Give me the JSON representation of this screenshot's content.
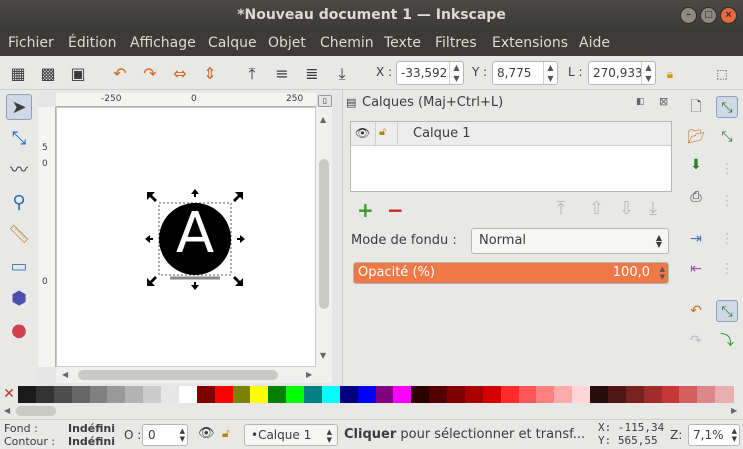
{
  "window": {
    "title": "*Nouveau document 1 — Inkscape",
    "close": "×",
    "minimize": "–",
    "maximize": "□"
  },
  "menu": [
    "Fichier",
    "Édition",
    "Affichage",
    "Calque",
    "Objet",
    "Chemin",
    "Texte",
    "Filtres",
    "Extensions",
    "Aide"
  ],
  "toolbar": {
    "x_label": "X :",
    "x_value": "-33,592",
    "y_label": "Y :",
    "y_value": "8,775",
    "l_label": "L :",
    "l_value": "270,933"
  },
  "ruler": {
    "h_labels": [
      "-250",
      "0",
      "250"
    ],
    "v_labels": [
      "5",
      "0",
      "0"
    ]
  },
  "canvas": {
    "glyph": "A"
  },
  "layers_panel": {
    "title": "Calques (Maj+Ctrl+L)",
    "layer_name": "Calque 1",
    "blend_label": "Mode de fondu :",
    "blend_value": "Normal",
    "opacity_label": "Opacité (%)",
    "opacity_value": "100,0",
    "opacity_fraction": 1.0,
    "add_symbol": "+",
    "remove_symbol": "−"
  },
  "palette": {
    "none_symbol": "✕",
    "colors": [
      "#1a1a1a",
      "#333333",
      "#4d4d4d",
      "#666666",
      "#808080",
      "#999999",
      "#b3b3b3",
      "#cccccc",
      "#e6e6e6",
      "#ffffff",
      "#800000",
      "#ff0000",
      "#808000",
      "#ffff00",
      "#008000",
      "#00ff00",
      "#008080",
      "#00ffff",
      "#000080",
      "#0000ff",
      "#800080",
      "#ff00ff",
      "#2b0000",
      "#550000",
      "#800000",
      "#aa0000",
      "#d40000",
      "#ff2a2a",
      "#ff5555",
      "#ff8080",
      "#ffaaaa",
      "#ffd5d5",
      "#280b0b",
      "#501616",
      "#782121",
      "#a02c2c",
      "#c83737",
      "#d35f5f",
      "#de8787",
      "#e9afaf"
    ]
  },
  "status": {
    "fill_label": "Fond :",
    "fill_value": "Indéfini",
    "stroke_label": "Contour :",
    "stroke_value": "Indéfini",
    "opacity_label": "O :",
    "opacity_value": "0",
    "layer_value": "•Calque 1",
    "message_bold": "Cliquer",
    "message_rest": " pour sélectionner et transf...",
    "x_coord": "X: -115,34",
    "y_coord": "Y: 565,55",
    "zoom_label": "Z:",
    "zoom_value": "7,1%"
  }
}
